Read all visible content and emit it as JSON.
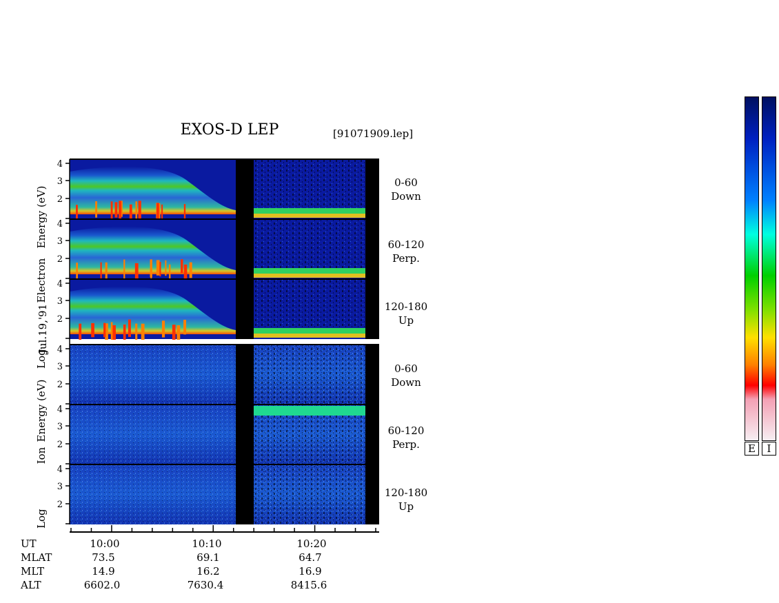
{
  "header": {
    "title": "EXOS-D LEP",
    "file": "[91071909.lep]"
  },
  "date_label": "Jul.19,'91",
  "electron_axis_label": {
    "log": "Log",
    "species": "Electron",
    "energy": "Energy (eV)"
  },
  "ion_axis_label": {
    "log": "Log",
    "species": "Ion",
    "energy": "Energy (eV)"
  },
  "panels": [
    {
      "species": "electron",
      "angle": "0-60",
      "direction": "Down"
    },
    {
      "species": "electron",
      "angle": "60-120",
      "direction": "Perp."
    },
    {
      "species": "electron",
      "angle": "120-180",
      "direction": "Up"
    },
    {
      "species": "ion",
      "angle": "0-60",
      "direction": "Down"
    },
    {
      "species": "ion",
      "angle": "60-120",
      "direction": "Perp."
    },
    {
      "species": "ion",
      "angle": "120-180",
      "direction": "Up"
    }
  ],
  "y_ticks": [
    "4",
    "3",
    "2"
  ],
  "orbit": {
    "labels": {
      "ut": "UT",
      "mlat": "MLAT",
      "mlt": "MLT",
      "alt": "ALT"
    },
    "columns": [
      {
        "ut": "10:00",
        "mlat": "73.5",
        "mlt": "14.9",
        "alt": "6602.0"
      },
      {
        "ut": "10:10",
        "mlat": "69.1",
        "mlt": "16.2",
        "alt": "7630.4"
      },
      {
        "ut": "10:20",
        "mlat": "64.7",
        "mlt": "16.9",
        "alt": "8415.6"
      }
    ]
  },
  "colorbars": [
    {
      "key": "E"
    },
    {
      "key": "I"
    }
  ],
  "colors": {
    "background_dark": "#0a1aa0",
    "gap": "#000000",
    "scale": [
      "#f4e6ee",
      "#f4a0b4",
      "#ff0000",
      "#ff8000",
      "#ffe000",
      "#00d000",
      "#00ffe0",
      "#0080ff",
      "#0020c0",
      "#001060"
    ]
  },
  "chart_data": {
    "type": "heatmap",
    "title": "EXOS-D LEP",
    "subtitle": "[91071909.lep]",
    "xlabel": "UT",
    "ylabel": "Log Energy (eV)",
    "x_ticks": [
      "10:00",
      "10:10",
      "10:20"
    ],
    "xlim": [
      "09:56",
      "10:26"
    ],
    "ylim": [
      1,
      4.1
    ],
    "y_ticks": [
      2,
      3,
      4
    ],
    "data_gap_ut": [
      "10:12",
      "10:14"
    ],
    "panels": [
      {
        "species": "Electron",
        "pitch_angle": "0-60",
        "direction": "Down"
      },
      {
        "species": "Electron",
        "pitch_angle": "60-120",
        "direction": "Perp."
      },
      {
        "species": "Electron",
        "pitch_angle": "120-180",
        "direction": "Up"
      },
      {
        "species": "Ion",
        "pitch_angle": "0-60",
        "direction": "Down"
      },
      {
        "species": "Ion",
        "pitch_angle": "60-120",
        "direction": "Perp."
      },
      {
        "species": "Ion",
        "pitch_angle": "120-180",
        "direction": "Up"
      }
    ],
    "colorbar_keys": [
      "E",
      "I"
    ]
  }
}
